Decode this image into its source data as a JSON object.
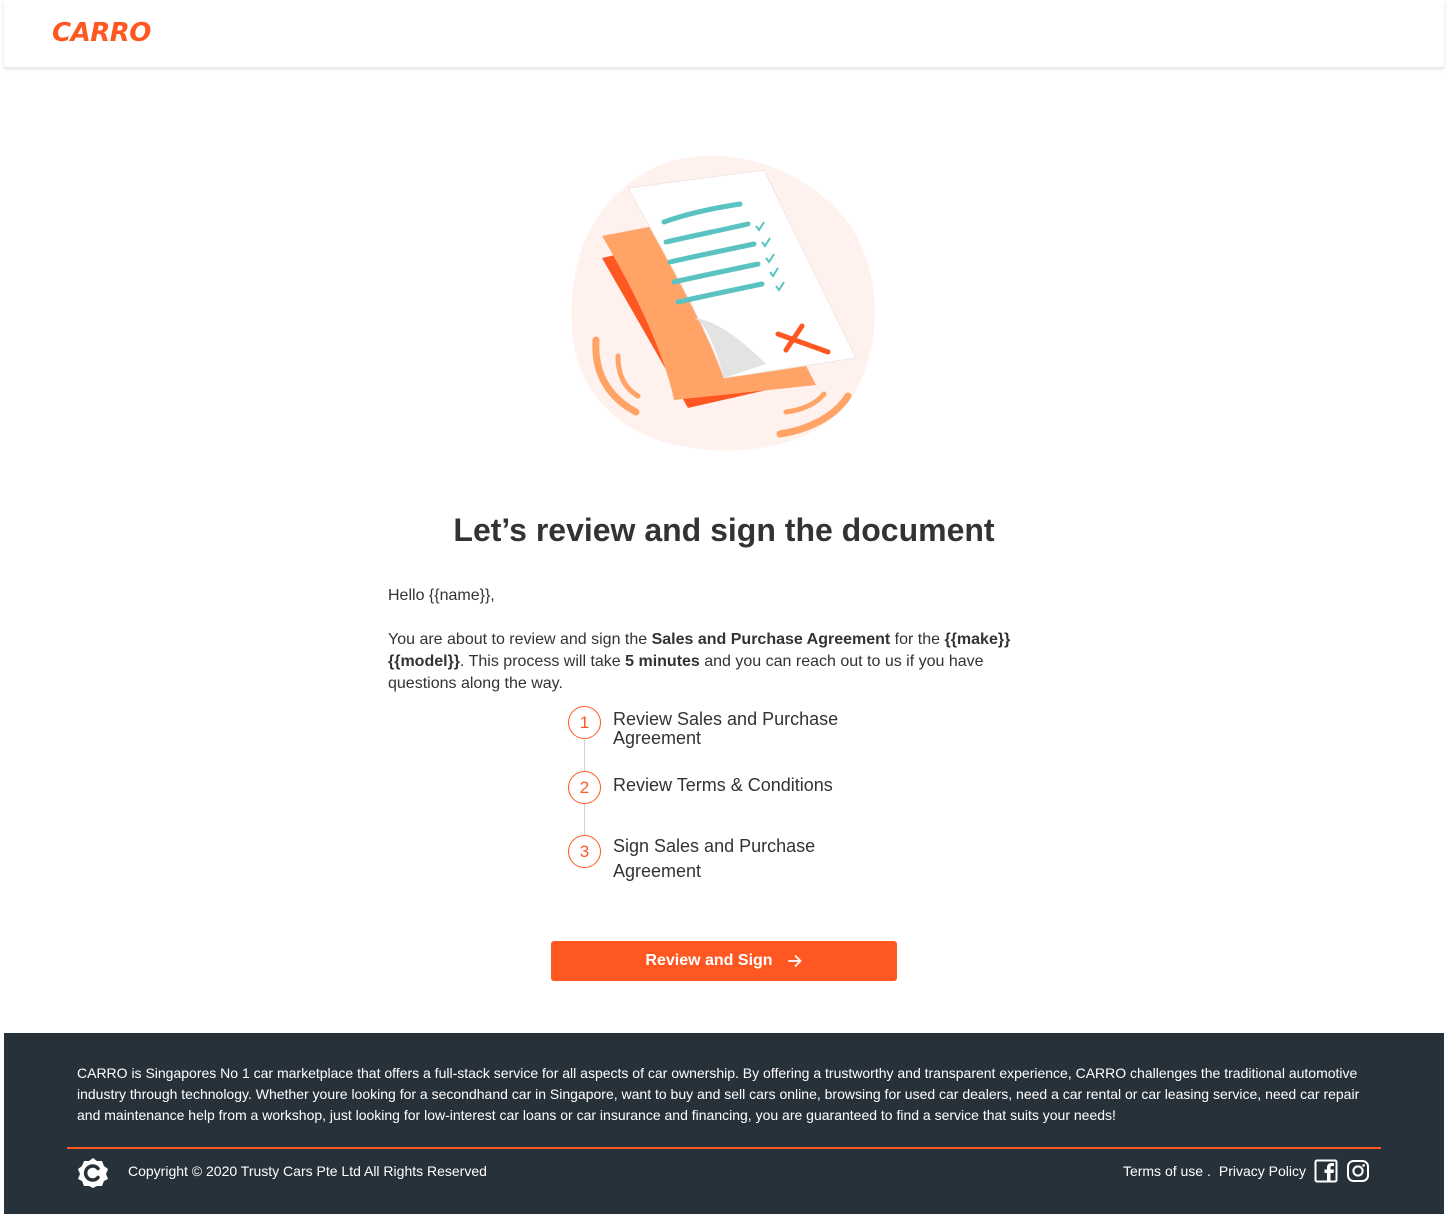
{
  "header": {
    "logo": "CARRO"
  },
  "page": {
    "title": "Let’s review and sign the document",
    "greeting": "Hello {{name}},",
    "intro": {
      "t1": "You are about to review and sign the ",
      "b1": "Sales and Purchase Agreement",
      "t2": " for the ",
      "b2": "{{make}} {{model}}",
      "t3": ". This process will take ",
      "b3": "5 minutes",
      "t4": " and you can reach out to us if you have questions along the way."
    }
  },
  "steps": [
    {
      "number": "1",
      "label": "Review Sales and Purchase Agreement"
    },
    {
      "number": "2",
      "label": "Review Terms & Conditions"
    },
    {
      "number": "3",
      "label": "Sign Sales and Purchase Agreement"
    }
  ],
  "cta": {
    "label": "Review and Sign",
    "icon": "arrow-right-icon"
  },
  "footer": {
    "about": "CARRO is Singapores No 1 car marketplace that offers a full-stack service for all aspects of car ownership. By offering a trustworthy and transparent experience, CARRO challenges the traditional automotive industry through technology. Whether youre looking for a secondhand car in Singapore, want to buy and sell cars online, browsing for used car dealers, need a car rental or car leasing service, need car repair and maintenance help from a workshop, just looking for low-interest car loans or car insurance and financing, you are guaranteed to find a service that suits your needs!",
    "copyright": "Copyright © 2020 Trusty Cars Pte Ltd All Rights Reserved",
    "terms": "Terms of use .",
    "privacy": "Privacy Policy",
    "social": [
      "facebook-icon",
      "instagram-icon"
    ]
  },
  "colors": {
    "brand": "#ff5722",
    "footer_bg": "#27313a",
    "text": "#333333"
  }
}
